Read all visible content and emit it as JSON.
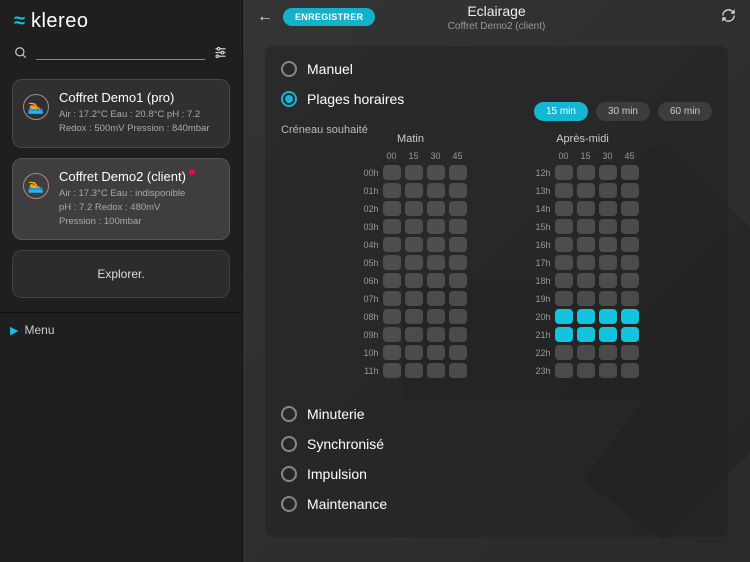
{
  "brand": "klereo",
  "search": {
    "placeholder": ""
  },
  "devices": [
    {
      "title": "Coffret Demo1 (pro)",
      "line1": "Air : 17.2°C   Eau : 20.8°C   pH : 7.2",
      "line2": "Redox : 500mV   Pression : 840mbar",
      "alert": false
    },
    {
      "title": "Coffret Demo2 (client)",
      "line1": "Air : 17.3°C   Eau : indisponible",
      "line2": "pH : 7.2   Redox : 480mV",
      "line3": "Pression : 100mbar",
      "alert": true
    }
  ],
  "explorer": "Explorer.",
  "menu": "Menu",
  "topbar": {
    "save": "ENREGISTRER",
    "title": "Eclairage",
    "subtitle": "Coffret Demo2 (client)"
  },
  "modes": {
    "manuel": "Manuel",
    "plages": "Plages horaires",
    "minuterie": "Minuterie",
    "synchronise": "Synchronisé",
    "impulsion": "Impulsion",
    "maintenance": "Maintenance",
    "selected": "plages"
  },
  "slot_section": "Créneau souhaité",
  "durations": {
    "d15": "15 min",
    "d30": "30 min",
    "d60": "60 min",
    "active": "d15"
  },
  "grid": {
    "cols": [
      "00",
      "15",
      "30",
      "45"
    ],
    "morning": {
      "title": "Matin",
      "hours": [
        "00h",
        "01h",
        "02h",
        "03h",
        "04h",
        "05h",
        "06h",
        "07h",
        "08h",
        "09h",
        "10h",
        "11h"
      ]
    },
    "afternoon": {
      "title": "Après-midi",
      "hours": [
        "12h",
        "13h",
        "14h",
        "15h",
        "16h",
        "17h",
        "18h",
        "19h",
        "20h",
        "21h",
        "22h",
        "23h"
      ]
    }
  },
  "selected_slots": {
    "afternoon": {
      "20h": [
        0,
        1,
        2,
        3
      ],
      "21h": [
        0,
        1,
        2,
        3
      ]
    }
  }
}
